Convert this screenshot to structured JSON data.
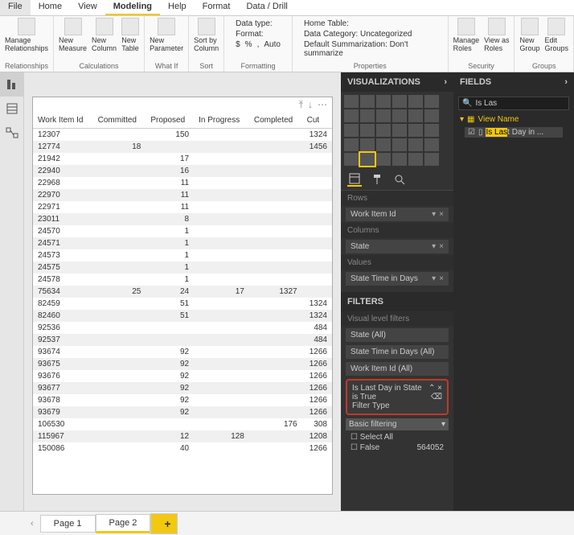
{
  "menubar": {
    "file": "File",
    "home": "Home",
    "view": "View",
    "modeling": "Modeling",
    "help": "Help",
    "format": "Format",
    "datadrill": "Data / Drill"
  },
  "ribbon": {
    "relationships": {
      "label": "Relationships",
      "manage": "Manage\nRelationships"
    },
    "calculations": {
      "label": "Calculations",
      "newMeasure": "New\nMeasure",
      "newColumn": "New\nColumn",
      "newTable": "New\nTable"
    },
    "whatif": {
      "label": "What If",
      "newParam": "New\nParameter"
    },
    "sort": {
      "label": "Sort",
      "sortby": "Sort by\nColumn"
    },
    "formatting": {
      "label": "Formatting",
      "datatype": "Data type:",
      "format": "Format:",
      "currency": "$",
      "percent": "%",
      "comma": ",",
      "auto": "Auto"
    },
    "properties": {
      "label": "Properties",
      "hometable": "Home Table:",
      "datacat": "Data Category: Uncategorized",
      "defsum": "Default Summarization: Don't summarize"
    },
    "security": {
      "label": "Security",
      "manageRoles": "Manage\nRoles",
      "viewAs": "View as\nRoles"
    },
    "groups": {
      "label": "Groups",
      "newGroup": "New\nGroup",
      "editGroups": "Edit\nGroups"
    }
  },
  "table": {
    "headers": [
      "Work Item Id",
      "Committed",
      "Proposed",
      "In Progress",
      "Completed",
      "Cut"
    ],
    "rows": [
      [
        "12307",
        "",
        "150",
        "",
        "",
        "1324"
      ],
      [
        "12774",
        "18",
        "",
        "",
        "",
        "1456"
      ],
      [
        "21942",
        "",
        "17",
        "",
        "",
        ""
      ],
      [
        "22940",
        "",
        "16",
        "",
        "",
        ""
      ],
      [
        "22968",
        "",
        "11",
        "",
        "",
        ""
      ],
      [
        "22970",
        "",
        "11",
        "",
        "",
        ""
      ],
      [
        "22971",
        "",
        "11",
        "",
        "",
        ""
      ],
      [
        "23011",
        "",
        "8",
        "",
        "",
        ""
      ],
      [
        "24570",
        "",
        "1",
        "",
        "",
        ""
      ],
      [
        "24571",
        "",
        "1",
        "",
        "",
        ""
      ],
      [
        "24573",
        "",
        "1",
        "",
        "",
        ""
      ],
      [
        "24575",
        "",
        "1",
        "",
        "",
        ""
      ],
      [
        "24578",
        "",
        "1",
        "",
        "",
        ""
      ],
      [
        "75634",
        "25",
        "24",
        "17",
        "1327",
        ""
      ],
      [
        "82459",
        "",
        "51",
        "",
        "",
        "1324"
      ],
      [
        "82460",
        "",
        "51",
        "",
        "",
        "1324"
      ],
      [
        "92536",
        "",
        "",
        "",
        "",
        "484"
      ],
      [
        "92537",
        "",
        "",
        "",
        "",
        "484"
      ],
      [
        "93674",
        "",
        "92",
        "",
        "",
        "1266"
      ],
      [
        "93675",
        "",
        "92",
        "",
        "",
        "1266"
      ],
      [
        "93676",
        "",
        "92",
        "",
        "",
        "1266"
      ],
      [
        "93677",
        "",
        "92",
        "",
        "",
        "1266"
      ],
      [
        "93678",
        "",
        "92",
        "",
        "",
        "1266"
      ],
      [
        "93679",
        "",
        "92",
        "",
        "",
        "1266"
      ],
      [
        "106530",
        "",
        "",
        "",
        "176",
        "308"
      ],
      [
        "115967",
        "",
        "12",
        "128",
        "",
        "1208"
      ],
      [
        "150086",
        "",
        "40",
        "",
        "",
        "1266"
      ]
    ]
  },
  "viz": {
    "title": "VISUALIZATIONS",
    "rows": "Rows",
    "rowsField": "Work Item Id",
    "columns": "Columns",
    "columnsField": "State",
    "values": "Values",
    "valuesField": "State Time in Days",
    "filtersTitle": "FILTERS",
    "vlf": "Visual level filters",
    "f1": "State",
    "f1v": "(All)",
    "f2": "State Time in Days",
    "f2v": "(All)",
    "f3": "Work Item Id",
    "f3v": "(All)",
    "f4": "Is Last Day in State",
    "f4sub": "is True",
    "f4type": "Filter Type",
    "basic": "Basic filtering",
    "selAll": "Select All",
    "optFalse": "False",
    "optFalseN": "564052"
  },
  "fields": {
    "title": "FIELDS",
    "searchPrefix": "Is Las",
    "tableName": "View Name",
    "itemPrefix": "Is Las",
    "itemSuffix": "t Day in ..."
  },
  "pages": {
    "p1": "Page 1",
    "p2": "Page 2"
  }
}
